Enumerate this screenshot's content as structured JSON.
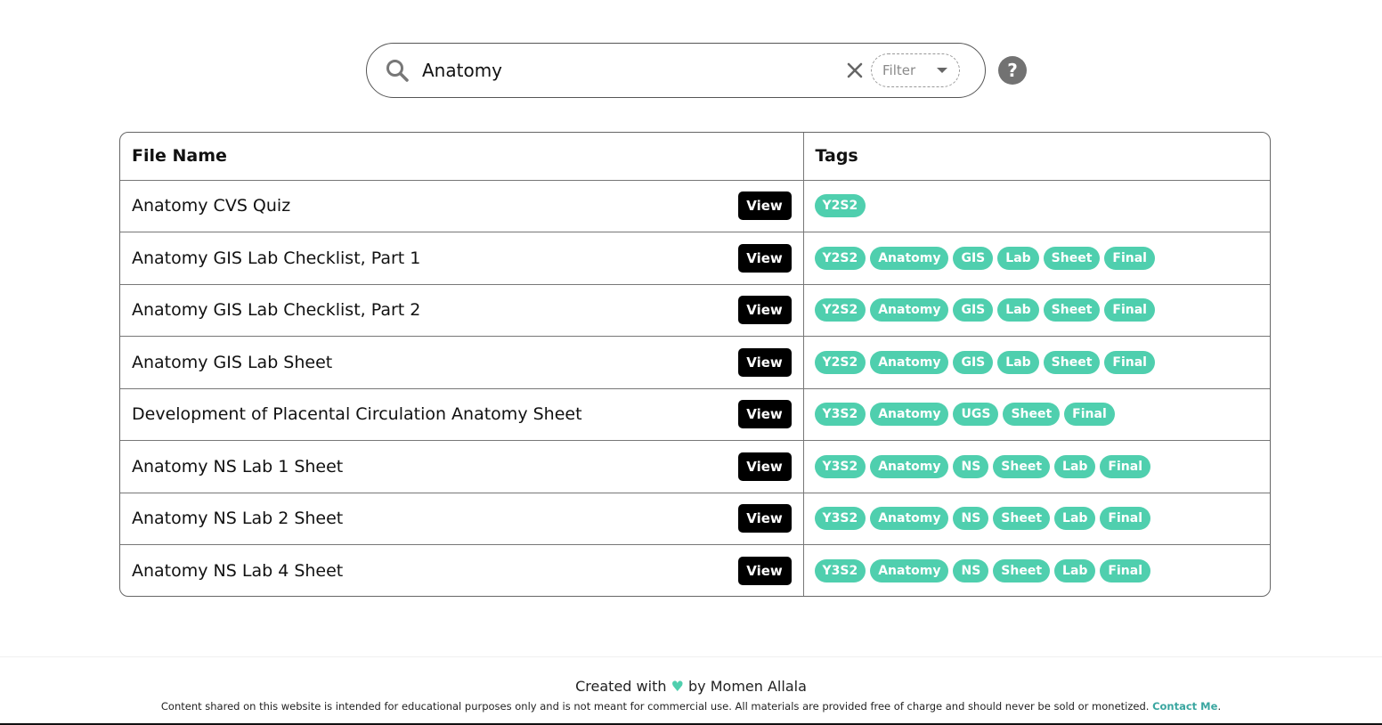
{
  "search": {
    "value": "Anatomy",
    "filter_placeholder": "Filter",
    "help_label": "?"
  },
  "table": {
    "headers": {
      "file_name": "File Name",
      "tags": "Tags"
    },
    "view_label": "View",
    "rows": [
      {
        "name": "Anatomy CVS Quiz",
        "tags": [
          "Y2S2"
        ]
      },
      {
        "name": "Anatomy GIS Lab Checklist, Part 1",
        "tags": [
          "Y2S2",
          "Anatomy",
          "GIS",
          "Lab",
          "Sheet",
          "Final"
        ]
      },
      {
        "name": "Anatomy GIS Lab Checklist, Part 2",
        "tags": [
          "Y2S2",
          "Anatomy",
          "GIS",
          "Lab",
          "Sheet",
          "Final"
        ]
      },
      {
        "name": "Anatomy GIS Lab Sheet",
        "tags": [
          "Y2S2",
          "Anatomy",
          "GIS",
          "Lab",
          "Sheet",
          "Final"
        ]
      },
      {
        "name": "Development of Placental Circulation Anatomy Sheet",
        "tags": [
          "Y3S2",
          "Anatomy",
          "UGS",
          "Sheet",
          "Final"
        ]
      },
      {
        "name": "Anatomy NS Lab 1 Sheet",
        "tags": [
          "Y3S2",
          "Anatomy",
          "NS",
          "Sheet",
          "Lab",
          "Final"
        ]
      },
      {
        "name": "Anatomy NS Lab 2 Sheet",
        "tags": [
          "Y3S2",
          "Anatomy",
          "NS",
          "Sheet",
          "Lab",
          "Final"
        ]
      },
      {
        "name": "Anatomy NS Lab 4 Sheet",
        "tags": [
          "Y3S2",
          "Anatomy",
          "NS",
          "Sheet",
          "Lab",
          "Final"
        ]
      }
    ]
  },
  "footer": {
    "created_prefix": "Created with",
    "heart": "♥",
    "created_suffix": "by Momen Allala",
    "disclaimer": "Content shared on this website is intended for educational purposes only and is not meant for commercial use. All materials are provided free of charge and should never be sold or monetized.",
    "contact_label": "Contact Me",
    "contact_suffix": "."
  },
  "colors": {
    "tag": "#4fcfae",
    "view_button": "#000000",
    "contact": "#3aa6a0"
  },
  "icons": {
    "search": "search-icon",
    "clear": "close-icon",
    "filter_caret": "caret-down-icon",
    "help": "help-icon"
  }
}
